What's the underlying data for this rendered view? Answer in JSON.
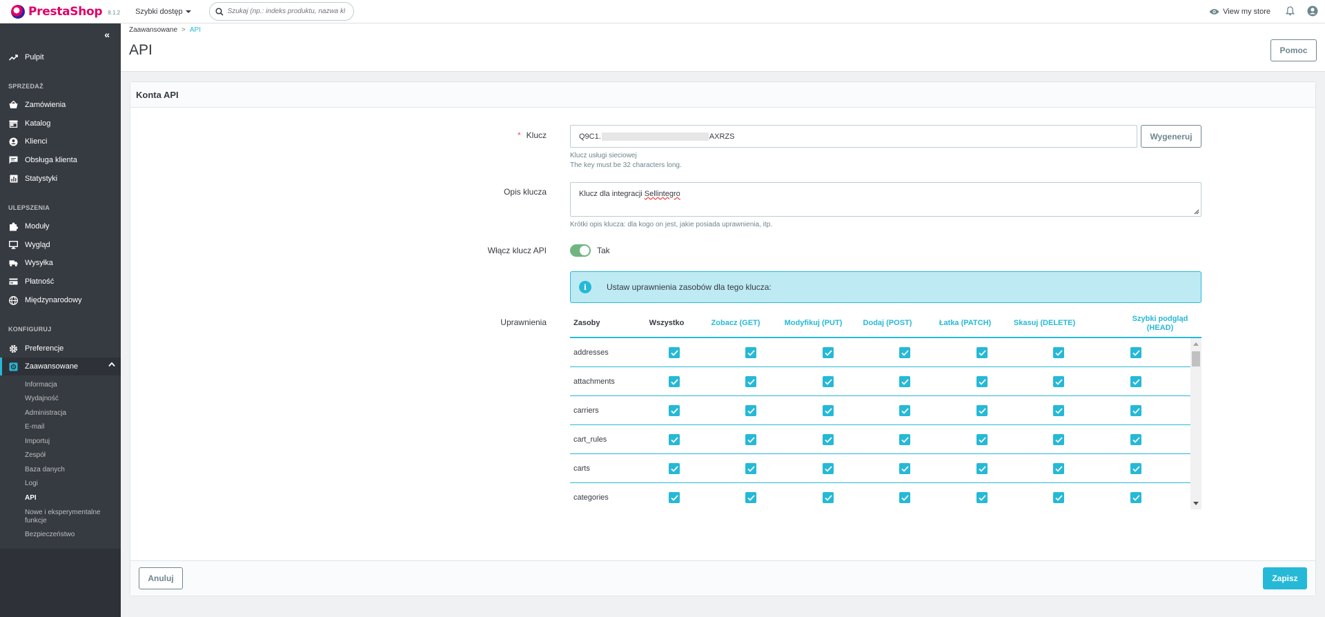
{
  "brand": {
    "name": "PrestaShop",
    "version": "8.1.2"
  },
  "topbar": {
    "quick_access": "Szybki dostęp",
    "search_placeholder": "Szukaj (np.: indeks produktu, nazwa kl",
    "view_store": "View my store"
  },
  "sidebar": {
    "dashboard": "Pulpit",
    "sections": {
      "sell": "SPRZEDAŻ",
      "improve": "ULEPSZENIA",
      "configure": "KONFIGURUJ"
    },
    "sell_items": [
      "Zamówienia",
      "Katalog",
      "Klienci",
      "Obsługa klienta",
      "Statystyki"
    ],
    "improve_items": [
      "Moduły",
      "Wygląd",
      "Wysyłka",
      "Płatność",
      "Międzynarodowy"
    ],
    "configure_items": [
      "Preferencje",
      "Zaawansowane"
    ],
    "advanced_sub": [
      "Informacja",
      "Wydajność",
      "Administracja",
      "E-mail",
      "Importuj",
      "Zespół",
      "Baza danych",
      "Logi",
      "API",
      "Nowe i eksperymentalne funkcje",
      "Bezpieczeństwo"
    ]
  },
  "header": {
    "breadcrumb_parent": "Zaawansowane",
    "breadcrumb_sep": ">",
    "breadcrumb_current": "API",
    "title": "API",
    "help": "Pomoc"
  },
  "card": {
    "title": "Konta API",
    "key_label": "Klucz",
    "required_mark": "*",
    "key_value_start": "Q9C1.",
    "key_value_end": "AXRZS",
    "regenerate": "Wygeneruj",
    "key_hint1": "Klucz usługi sieciowej",
    "key_hint2": "The key must be 32 characters long.",
    "desc_label": "Opis klucza",
    "desc_value_start": "Klucz dla integracji ",
    "desc_value_word": "Sellintegro",
    "desc_hint": "Krótki opis klucza: dla kogo on jest, jakie posiada uprawnienia, itp.",
    "enable_label": "Włącz klucz API",
    "enable_value": "Tak",
    "alert_icon": "i",
    "alert_text": "Ustaw uprawnienia zasobów dla tego klucza:",
    "perm_label": "Uprawnienia",
    "cancel": "Anuluj",
    "save": "Zapisz"
  },
  "permissions": {
    "columns": [
      "Zasoby",
      "Wszystko",
      "Zobacz (GET)",
      "Modyfikuj (PUT)",
      "Dodaj (POST)",
      "Łatka (PATCH)",
      "Skasuj (DELETE)",
      "Szybki podgląd (HEAD)"
    ],
    "rows": [
      {
        "resource": "addresses",
        "all": true,
        "get": true,
        "put": true,
        "post": true,
        "patch": true,
        "delete": true,
        "head": true
      },
      {
        "resource": "attachments",
        "all": true,
        "get": true,
        "put": true,
        "post": true,
        "patch": true,
        "delete": true,
        "head": true
      },
      {
        "resource": "carriers",
        "all": true,
        "get": true,
        "put": true,
        "post": true,
        "patch": true,
        "delete": true,
        "head": true
      },
      {
        "resource": "cart_rules",
        "all": true,
        "get": true,
        "put": true,
        "post": true,
        "patch": true,
        "delete": true,
        "head": true
      },
      {
        "resource": "carts",
        "all": true,
        "get": true,
        "put": true,
        "post": true,
        "patch": true,
        "delete": true,
        "head": true
      },
      {
        "resource": "categories",
        "all": true,
        "get": true,
        "put": true,
        "post": true,
        "patch": true,
        "delete": true,
        "head": true
      }
    ]
  },
  "colors": {
    "accent": "#25b9d7",
    "sidebar": "#363a41",
    "toggle_on": "#70b580",
    "brand": "#df0067"
  }
}
